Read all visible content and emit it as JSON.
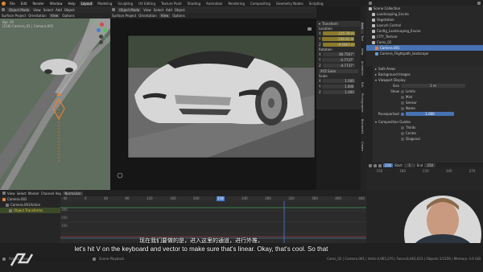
{
  "menu": [
    "File",
    "Edit",
    "Render",
    "Window",
    "Help"
  ],
  "workspaces": [
    "Layout",
    "Modeling",
    "Sculpting",
    "UV Editing",
    "Texture Paint",
    "Shading",
    "Animation",
    "Rendering",
    "Compositing",
    "Geometry Nodes",
    "Scripting"
  ],
  "active_workspace": "Layout",
  "scene": {
    "label": "Scene",
    "view_layer": "ViewLayer"
  },
  "left_viewport": {
    "mode": "Object Mode",
    "menu": [
      "View",
      "Select",
      "Add",
      "Object"
    ],
    "info_lines": [
      "Bpc 19",
      "(218) Camera_01 | Camera.001"
    ],
    "snap": "Surface Project",
    "orientation": "Orientation",
    "orientation_value": "View",
    "options": "Options"
  },
  "center_viewport": {
    "mode": "Object Mode",
    "menu": [
      "View",
      "Select",
      "Add",
      "Object"
    ],
    "snap": "Surface Project",
    "orientation": "Orientation",
    "orientation_value": "View",
    "options": "Options"
  },
  "npanel": {
    "header": "Transform",
    "location_label": "Location",
    "location": [
      {
        "axis": "X",
        "value": "-145.78 m"
      },
      {
        "axis": "Y",
        "value": "-246.61 m"
      },
      {
        "axis": "Z",
        "value": "-9.5967 m"
      }
    ],
    "rotation_label": "Rotation",
    "rotation": [
      {
        "axis": "X",
        "value": "80.7567°"
      },
      {
        "axis": "Y",
        "value": "-0.7737°"
      },
      {
        "axis": "Z",
        "value": "-4.7737°"
      }
    ],
    "rotation_mode": "XYZ Euler",
    "scale_label": "Scale",
    "scale": [
      {
        "axis": "X",
        "value": "1.000"
      },
      {
        "axis": "Y",
        "value": "1.000"
      },
      {
        "axis": "Z",
        "value": "1.000"
      }
    ]
  },
  "side_tabs": [
    "Item",
    "Tool",
    "View",
    "Animation",
    "Edit",
    "Photographer",
    "BlenderKit",
    "Create"
  ],
  "outliner": {
    "title": "Scene Collection",
    "items": [
      "Scene Collection",
      "Landscaping_Enviro",
      "Vegetation",
      "Launch Control",
      "Config_Landscaping_Enviro",
      "CITY_Texture",
      "Cams_02",
      "Camera.001",
      "Camera_Flightpath_landscape"
    ]
  },
  "properties": {
    "sections": [
      {
        "label": "Safe Areas"
      },
      {
        "label": "Background Images"
      },
      {
        "label": "Viewport Display"
      }
    ],
    "size_label": "Size",
    "size_value": "1 m",
    "show_label": "Show",
    "checks": [
      "Limits",
      "Mist",
      "Sensor",
      "Name"
    ],
    "passepartout_label": "Passepartout",
    "passepartout_value": "1.000",
    "composition_label": "Composition Guides",
    "comp_checks": [
      "Thirds",
      "Center",
      "Diagonal"
    ]
  },
  "timeline_right": {
    "start_label": "Start",
    "start": "1",
    "end_label": "End",
    "end": "250",
    "current": "218",
    "ruler": [
      "150",
      "180",
      "210",
      "240",
      "270"
    ]
  },
  "graph_editor": {
    "menu": [
      "View",
      "Select",
      "Marker",
      "Channel",
      "Key"
    ],
    "normalize": "Normalize",
    "ruler": [
      "-40",
      "0",
      "40",
      "80",
      "120",
      "160",
      "200",
      "218",
      "240",
      "280",
      "320",
      "360",
      "400",
      "440"
    ],
    "current_frame": "218",
    "channels": [
      "Camera.001",
      "Camera.001Action",
      "Object Transforms"
    ],
    "yaxis": [
      "300",
      "200",
      "100"
    ]
  },
  "status_bar": {
    "left_hint": "Rotate View",
    "mid_hint": "Scene Playback",
    "right_info": "Cams_02 | Camera.001 | Verts:4,965,270 | Faces:8,463,023 | Objects:1/1256 | Memory: 3.6 GiB"
  },
  "subtitles": {
    "chinese": "现在我们要做的是，进入这里的通道，进行外推，",
    "english": "let's hit V on the keyboard and vector to make sure that's linear. Okay, that's cool. So that"
  },
  "colors": {
    "accent": "#4772b3",
    "playhead": "#4b7fd6",
    "orange": "#e8823a",
    "yellow_field": "#8a7a2a"
  }
}
